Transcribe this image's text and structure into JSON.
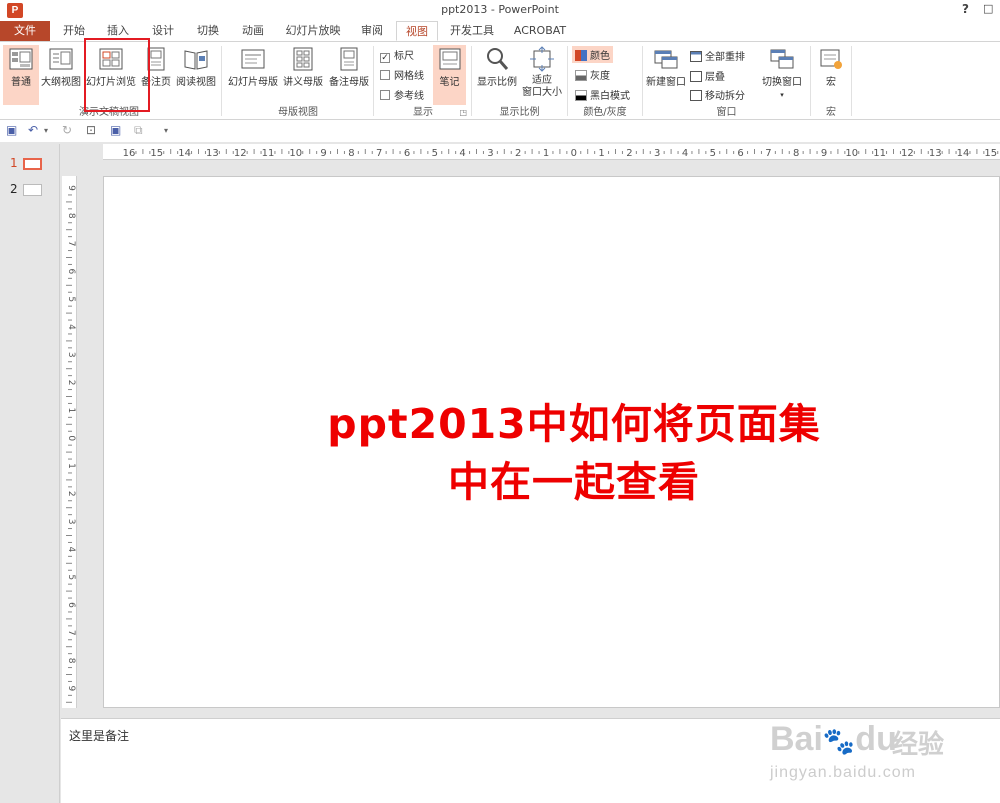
{
  "window": {
    "title": "ppt2013 - PowerPoint",
    "app_icon": "P",
    "help": "?",
    "restore": "□"
  },
  "tabs": [
    "文件",
    "开始",
    "插入",
    "设计",
    "切换",
    "动画",
    "幻灯片放映",
    "审阅",
    "视图",
    "开发工具",
    "ACROBAT"
  ],
  "active_tab": "视图",
  "ribbon": {
    "presentation_views": {
      "label": "演示文稿视图",
      "buttons": [
        "普通",
        "大纲视图",
        "幻灯片浏览",
        "备注页",
        "阅读视图"
      ]
    },
    "master_views": {
      "label": "母版视图",
      "buttons": [
        "幻灯片母版",
        "讲义母版",
        "备注母版"
      ]
    },
    "show": {
      "label": "显示",
      "checkboxes": [
        {
          "label": "标尺",
          "checked": true
        },
        {
          "label": "网格线",
          "checked": false
        },
        {
          "label": "参考线",
          "checked": false
        }
      ],
      "notes_button": "笔记"
    },
    "zoom": {
      "label": "显示比例",
      "buttons": [
        "显示比例",
        "适应",
        "窗口大小"
      ]
    },
    "color": {
      "label": "颜色/灰度",
      "buttons": [
        "颜色",
        "灰度",
        "黑白模式"
      ]
    },
    "window": {
      "label": "窗口",
      "new_window": "新建窗口",
      "small": [
        "全部重排",
        "层叠",
        "移动拆分"
      ],
      "switch": "切换窗口"
    },
    "macros": {
      "label": "宏",
      "button": "宏"
    }
  },
  "rulers": {
    "horizontal": [
      "16",
      "15",
      "14",
      "13",
      "12",
      "11",
      "10",
      "9",
      "8",
      "7",
      "6",
      "5",
      "4",
      "3",
      "2",
      "1",
      "0",
      "1",
      "2",
      "3",
      "4",
      "5",
      "6",
      "7",
      "8",
      "9",
      "10",
      "11",
      "12",
      "13",
      "14",
      "15"
    ],
    "vertical": [
      "9",
      "8",
      "7",
      "6",
      "5",
      "4",
      "3",
      "2",
      "1",
      "0",
      "1",
      "2",
      "3",
      "4",
      "5",
      "6",
      "7",
      "8",
      "9"
    ]
  },
  "slides": [
    {
      "number": "1"
    },
    {
      "number": "2"
    }
  ],
  "slide": {
    "title_line1": "ppt2013中如何将页面集",
    "title_line2": "中在一起查看",
    "title_color": "#ee0000"
  },
  "notes": {
    "text": "这里是备注"
  },
  "watermark": {
    "brand": "Bai",
    "brand_suffix": "du",
    "product": "经验",
    "url": "jingyan.baidu.com"
  },
  "colors": {
    "accent": "#b7472a",
    "highlight": "#e31b23",
    "pressed": "#fcd5c6"
  }
}
